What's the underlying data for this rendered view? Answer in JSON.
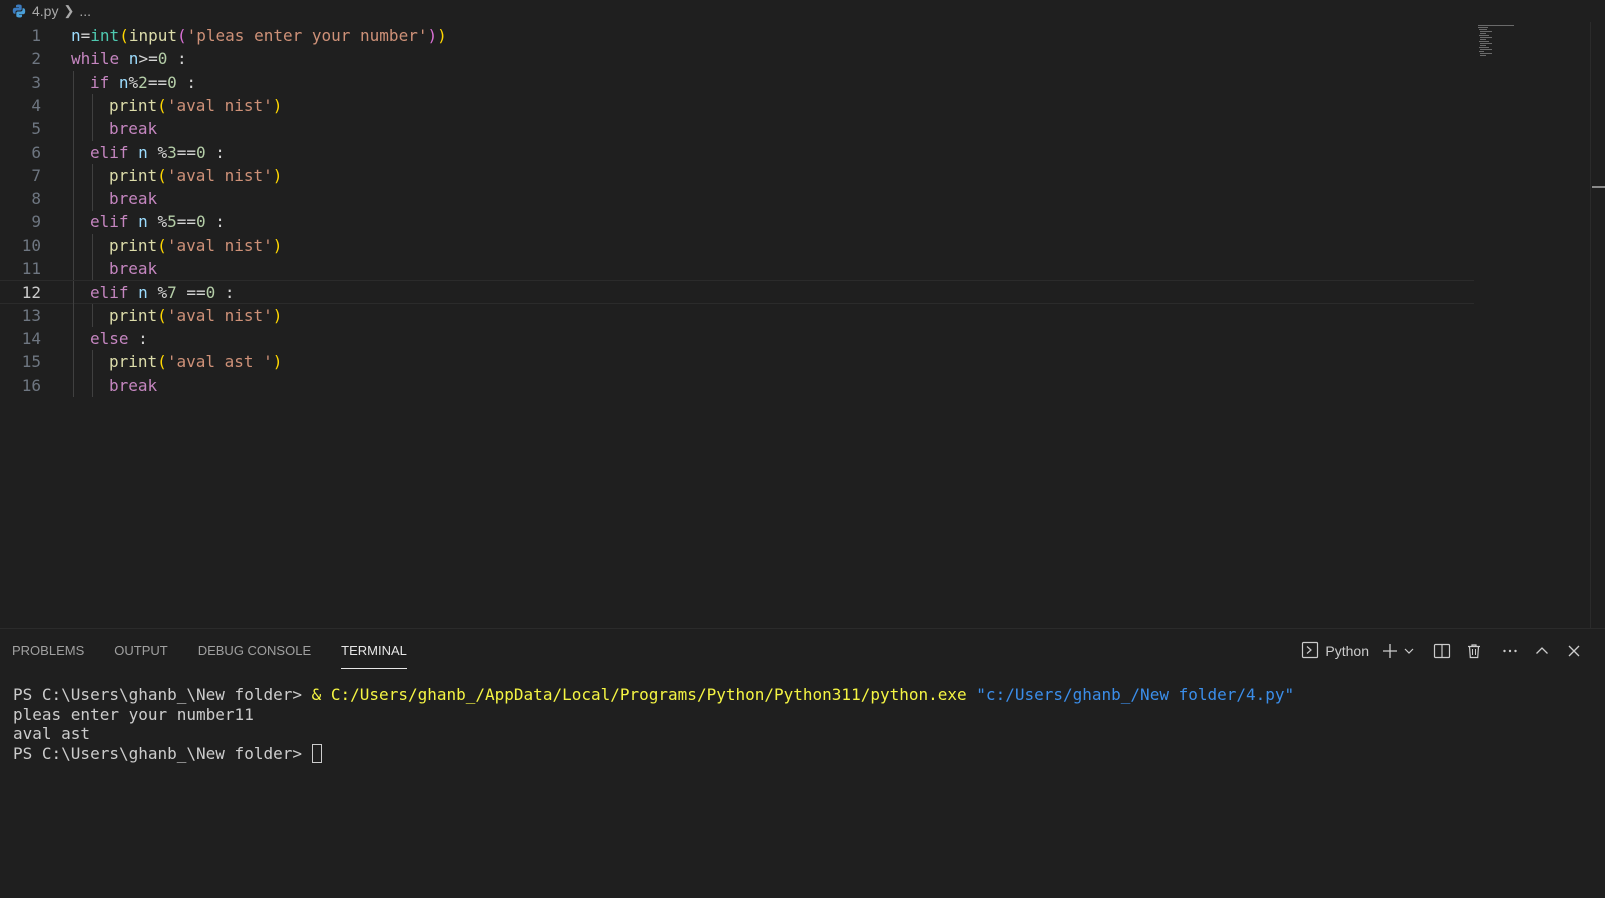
{
  "breadcrumb": {
    "file": "4.py",
    "ellipsis": "..."
  },
  "editor": {
    "language_icon": "python-icon",
    "active_line": 12,
    "lines": [
      {
        "n": "1"
      },
      {
        "n": "2"
      },
      {
        "n": "3"
      },
      {
        "n": "4"
      },
      {
        "n": "5"
      },
      {
        "n": "6"
      },
      {
        "n": "7"
      },
      {
        "n": "8"
      },
      {
        "n": "9"
      },
      {
        "n": "10"
      },
      {
        "n": "11"
      },
      {
        "n": "12"
      },
      {
        "n": "13"
      },
      {
        "n": "14"
      },
      {
        "n": "15"
      },
      {
        "n": "16"
      }
    ],
    "code": {
      "l1": {
        "a": "n",
        "b": "=",
        "c": "int",
        "d": "(",
        "e": "input",
        "f": "(",
        "g": "'pleas enter your number'",
        "h": ")",
        "i": ")"
      },
      "l2": {
        "a": "while",
        "b": " n",
        "c": ">=",
        "d": "0",
        "e": " :"
      },
      "l3": {
        "a": "if",
        "b": " n",
        "c": "%",
        "d": "2",
        "e": "==",
        "f": "0",
        "g": " :"
      },
      "l4": {
        "a": "print",
        "b": "(",
        "c": "'aval nist'",
        "d": ")"
      },
      "l5": {
        "a": "break"
      },
      "l6": {
        "a": "elif",
        "b": " n ",
        "c": "%",
        "d": "3",
        "e": "==",
        "f": "0",
        "g": " :"
      },
      "l7": {
        "a": "print",
        "b": "(",
        "c": "'aval nist'",
        "d": ")"
      },
      "l8": {
        "a": "break"
      },
      "l9": {
        "a": "elif",
        "b": " n ",
        "c": "%",
        "d": "5",
        "e": "==",
        "f": "0",
        "g": " :"
      },
      "l10": {
        "a": "print",
        "b": "(",
        "c": "'aval nist'",
        "d": ")"
      },
      "l11": {
        "a": "break"
      },
      "l12": {
        "a": "elif",
        "b": " n ",
        "c": "%",
        "d": "7",
        "e": " ==",
        "f": "0",
        "g": " :"
      },
      "l13": {
        "a": "print",
        "b": "(",
        "c": "'aval nist'",
        "d": ")"
      },
      "l14": {
        "a": "else",
        "b": " :"
      },
      "l15": {
        "a": "print",
        "b": "(",
        "c": "'aval ast '",
        "d": ")"
      },
      "l16": {
        "a": "break"
      }
    }
  },
  "panel": {
    "tabs": [
      "PROBLEMS",
      "OUTPUT",
      "DEBUG CONSOLE",
      "TERMINAL"
    ],
    "active_tab": "TERMINAL",
    "terminal_name": "Python",
    "actions": [
      "terminal-icon",
      "add-icon",
      "chevron-down-icon",
      "split-icon",
      "trash-icon",
      "more-icon",
      "chevron-up-icon",
      "close-icon"
    ]
  },
  "terminal": {
    "line1_prompt": "PS C:\\Users\\ghanb_\\New folder> ",
    "line1_amp": "& ",
    "line1_exe": "C:/Users/ghanb_/AppData/Local/Programs/Python/Python311/python.exe",
    "line1_arg": "\"c:/Users/ghanb_/New folder/4.py\"",
    "line2": "pleas enter your number11",
    "line3": "aval ast",
    "line4_prompt": "PS C:\\Users\\ghanb_\\New folder> "
  }
}
